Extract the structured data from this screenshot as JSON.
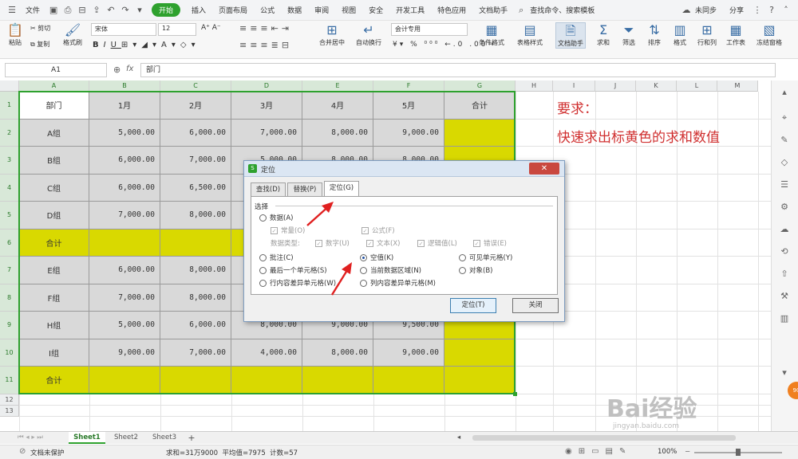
{
  "menubar": {
    "file": "文件",
    "tabs": [
      "开始",
      "插入",
      "页面布局",
      "公式",
      "数据",
      "审阅",
      "视图",
      "安全",
      "开发工具",
      "特色应用",
      "文档助手"
    ],
    "search": "查找命令、搜索模板",
    "sync": "未同步",
    "share": "分享"
  },
  "ribbon": {
    "paste": "粘贴",
    "cut": "剪切",
    "copy": "复制",
    "format_painter": "格式刷",
    "font": "宋体",
    "size": "12",
    "merge": "合并居中",
    "wrap": "自动换行",
    "num_format": "会计专用",
    "cond_format": "条件格式",
    "table_style": "表格样式",
    "doc_helper": "文档助手",
    "sum": "求和",
    "filter": "筛选",
    "sort": "排序",
    "format": "格式",
    "rowcol": "行和列",
    "sheet": "工作表",
    "freeze": "冻结窗格"
  },
  "formula": {
    "cell": "A1",
    "fx": "fx",
    "value": "部门"
  },
  "columns": [
    "A",
    "B",
    "C",
    "D",
    "E",
    "F",
    "G",
    "H",
    "I",
    "J",
    "K",
    "L",
    "M"
  ],
  "rows": [
    "1",
    "2",
    "3",
    "4",
    "5",
    "6",
    "7",
    "8",
    "9",
    "10",
    "11",
    "12",
    "13"
  ],
  "table": [
    [
      "部门",
      "1月",
      "2月",
      "3月",
      "4月",
      "5月",
      "合计"
    ],
    [
      "A组",
      "5,000.00",
      "6,000.00",
      "7,000.00",
      "8,000.00",
      "9,000.00",
      ""
    ],
    [
      "B组",
      "6,000.00",
      "7,000.00",
      "5,000.00",
      "8,000.00",
      "8,000.00",
      ""
    ],
    [
      "C组",
      "6,000.00",
      "6,500.00",
      "",
      "",
      "",
      ""
    ],
    [
      "D组",
      "7,000.00",
      "8,000.00",
      "",
      "",
      "",
      ""
    ],
    [
      "合计",
      "",
      "",
      "",
      "",
      "",
      ""
    ],
    [
      "E组",
      "6,000.00",
      "8,000.00",
      "",
      "",
      "",
      ""
    ],
    [
      "F组",
      "7,000.00",
      "8,000.00",
      "",
      "",
      "",
      ""
    ],
    [
      "H组",
      "5,000.00",
      "6,000.00",
      "8,000.00",
      "9,000.00",
      "9,500.00",
      ""
    ],
    [
      "I组",
      "9,000.00",
      "7,000.00",
      "4,000.00",
      "8,000.00",
      "9,000.00",
      ""
    ],
    [
      "合计",
      "",
      "",
      "",
      "",
      "",
      ""
    ]
  ],
  "notes": {
    "line1": "要求：",
    "line2": "快速求出标黄色的求和数值"
  },
  "sheets": [
    "Sheet1",
    "Sheet2",
    "Sheet3"
  ],
  "status": {
    "protect": "文档未保护",
    "summary": "求和=31万9000  平均值=7975  计数=57",
    "zoom": "100%"
  },
  "dialog": {
    "title": "定位",
    "tabs": [
      "查找(D)",
      "替换(P)",
      "定位(G)"
    ],
    "section": "选择",
    "opts": {
      "data": "数据(A)",
      "const": "常量(O)",
      "formula": "公式(F)",
      "dtype": "数据类型:",
      "num": "数字(U)",
      "text": "文本(X)",
      "logic": "逻辑值(L)",
      "err": "错误(E)",
      "comment": "批注(C)",
      "last": "最后一个单元格(S)",
      "rowdiff": "行内容差异单元格(W)",
      "blank": "空值(K)",
      "region": "当前数据区域(N)",
      "coldiff": "列内容差异单元格(M)",
      "visible": "可见单元格(Y)",
      "obj": "对象(B)"
    },
    "ok": "定位(T)",
    "close": "关闭"
  },
  "watermark": "Bai经验",
  "watermark_url": "jingyan.baidu.com",
  "colors": {
    "yellow": "#d9d900",
    "gray": "#d9d9d9",
    "green": "#2ea12e",
    "note": "#d03030"
  }
}
